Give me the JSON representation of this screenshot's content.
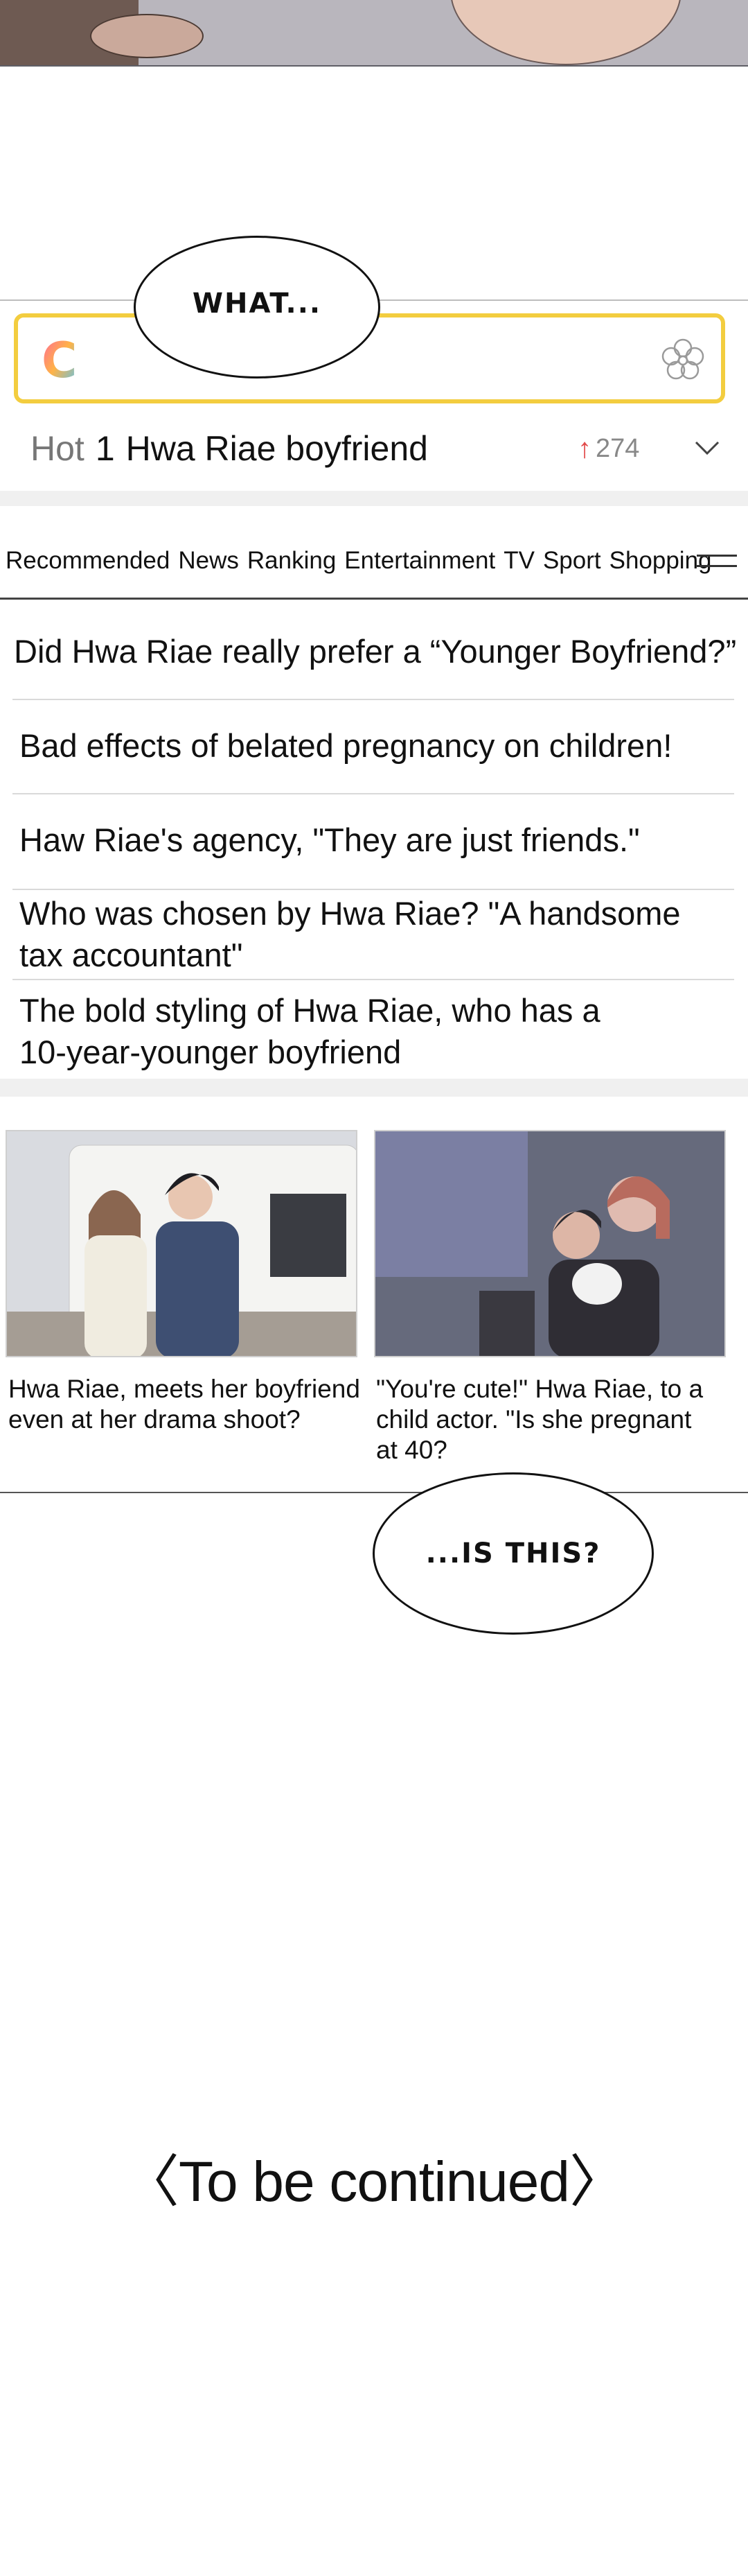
{
  "panel_top": {
    "speech": "WHAT..."
  },
  "search": {
    "logo_letter": "C"
  },
  "hot": {
    "label": "Hot",
    "rank": "1",
    "title": "Hwa Riae boyfriend",
    "arrow": "↑",
    "count": "274"
  },
  "tabs": [
    "Recommended",
    "News",
    "Ranking",
    "Entertainment",
    "TV",
    "Sport",
    "Shopping"
  ],
  "news": [
    [
      "Did Hwa Riae really prefer a “Younger Boyfriend?”"
    ],
    [
      "Bad effects of belated pregnancy on children!"
    ],
    [
      "Haw Riae's agency, \"They are just friends.\""
    ],
    [
      "Who was chosen by Hwa Riae? \"A handsome",
      "tax accountant\""
    ],
    [
      "The bold styling of Hwa Riae, who has a",
      "10-year-younger boyfriend"
    ]
  ],
  "cards": [
    {
      "caption": [
        "Hwa Riae, meets her boyfriend",
        "even at her drama shoot?"
      ]
    },
    {
      "caption": [
        "\"You're cute!\" Hwa Riae, to a",
        "child actor. \"Is she pregnant",
        "at 40?"
      ]
    }
  ],
  "panel_bottom": {
    "speech": "...IS THIS?"
  },
  "ending": "〈To be continued〉",
  "colors": {
    "search_border": "#f3cd3f",
    "hot_arrow": "#e24a4a",
    "band": "#f0f0f0"
  }
}
